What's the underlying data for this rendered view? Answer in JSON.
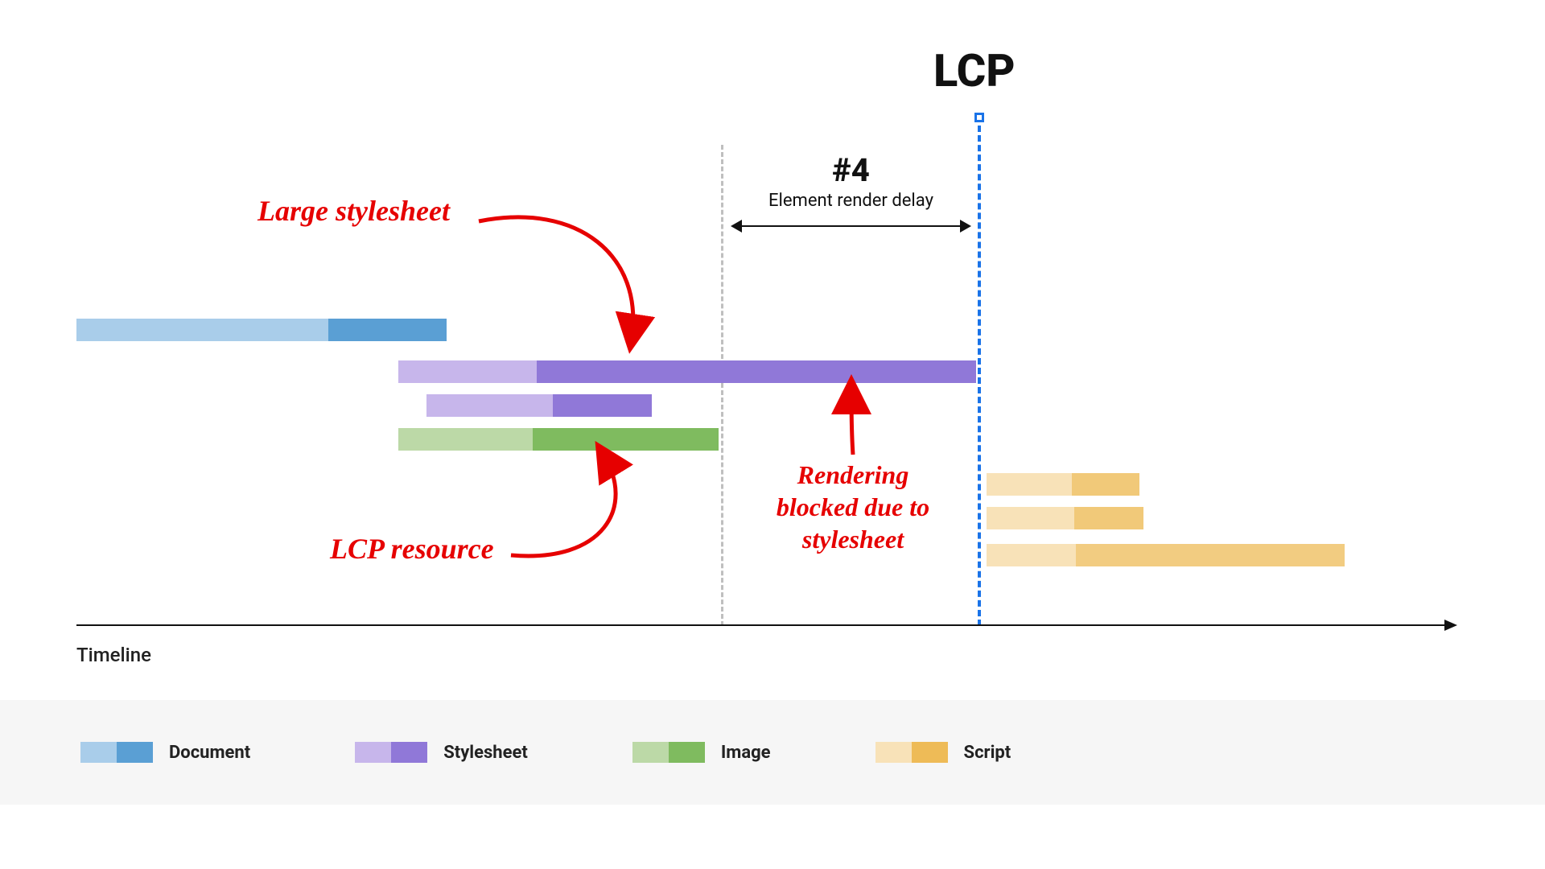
{
  "title_lcp": "LCP",
  "phase": {
    "num": "#4",
    "name": "Element render delay"
  },
  "annotations": {
    "large_stylesheet": "Large stylesheet",
    "lcp_resource": "LCP resource",
    "rendering_blocked": "Rendering\nblocked due to\nstylesheet"
  },
  "axis_label": "Timeline",
  "legend": {
    "document": "Document",
    "stylesheet": "Stylesheet",
    "image": "Image",
    "script": "Script"
  },
  "colors": {
    "doc_light": "#a9cdea",
    "doc_dark": "#5a9fd4",
    "style_light": "#c7b6eb",
    "style_dark": "#9078d8",
    "img_light": "#bcd9a7",
    "img_dark": "#7fbb5f",
    "script_light": "#f8e2b8",
    "script_dark": "#eebb57",
    "red": "#e60000"
  },
  "chart_data": {
    "type": "gantt-waterfall",
    "x_range": [
      0,
      100
    ],
    "markers": {
      "render_blocked_start": 50,
      "lcp": 70
    },
    "phase_span": {
      "from": 50,
      "to": 70,
      "label": "#4 Element render delay"
    },
    "tracks": [
      {
        "name": "document",
        "type": "Document",
        "start": 0,
        "split": 18,
        "end": 25
      },
      {
        "name": "stylesheet-large",
        "type": "Stylesheet",
        "start": 22,
        "split": 33,
        "end": 70,
        "annotation": "Large stylesheet"
      },
      {
        "name": "stylesheet-small",
        "type": "Stylesheet",
        "start": 25,
        "split": 37,
        "end": 45
      },
      {
        "name": "image-lcp",
        "type": "Image",
        "start": 22,
        "split": 33,
        "end": 50,
        "annotation": "LCP resource"
      },
      {
        "name": "script-1",
        "type": "Script",
        "start": 71,
        "split": 78,
        "end": 83
      },
      {
        "name": "script-2",
        "type": "Script",
        "start": 71,
        "split": 78,
        "end": 83
      },
      {
        "name": "script-3",
        "type": "Script",
        "start": 71,
        "split": 78,
        "end": 98
      }
    ]
  }
}
